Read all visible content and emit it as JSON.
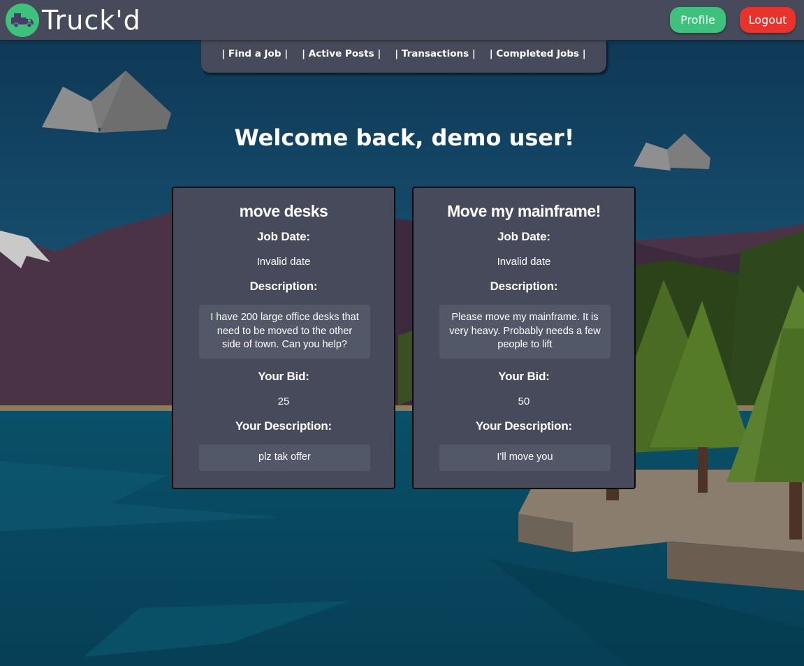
{
  "app": {
    "logo_text": "Truck'd"
  },
  "header": {
    "profile_label": "Profile",
    "logout_label": "Logout"
  },
  "nav": {
    "items": [
      {
        "label": "| Find a Job |"
      },
      {
        "label": "| Active Posts |"
      },
      {
        "label": "| Transactions |"
      },
      {
        "label": "| Completed Jobs |"
      }
    ]
  },
  "welcome": {
    "text": "Welcome back, demo user!"
  },
  "labels": {
    "job_date": "Job Date:",
    "description": "Description:",
    "your_bid": "Your Bid:",
    "your_description": "Your Description:"
  },
  "jobs": [
    {
      "title": "move desks",
      "job_date": "Invalid date",
      "description": "I have 200 large office desks that need to be moved to the other side of town. Can you help?",
      "bid": "25",
      "your_description": "plz tak offer"
    },
    {
      "title": "Move my mainframe!",
      "job_date": "Invalid date",
      "description": "Please move my mainframe. It is very heavy. Probably needs a few people to lift",
      "bid": "50",
      "your_description": "I'll move you"
    }
  ],
  "colors": {
    "header_bg": "#474a5a",
    "profile_button": "#3ec17c",
    "logout_button": "#e8332c",
    "card_bg": "#474a5a",
    "desc_box_bg": "#535869"
  }
}
